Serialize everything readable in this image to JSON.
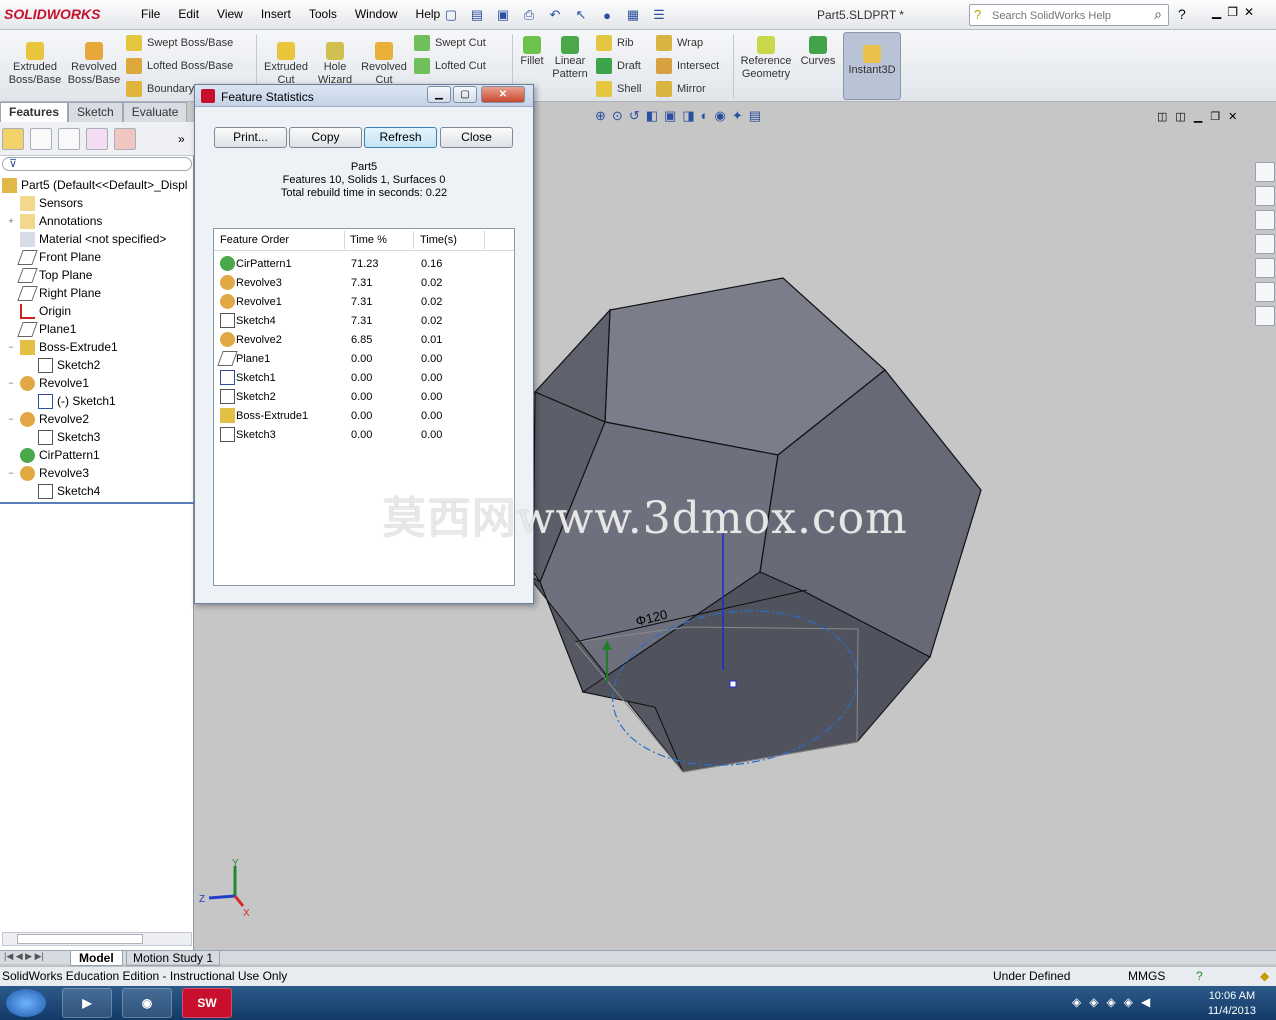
{
  "app": {
    "logo": "SOLIDWORKS",
    "menu": [
      "File",
      "Edit",
      "View",
      "Insert",
      "Tools",
      "Window",
      "Help"
    ],
    "doc_title": "Part5.SLDPRT *",
    "search_placeholder": "Search SolidWorks Help",
    "help_symbol": "?"
  },
  "ribbon": {
    "extruded_boss": "Extruded Boss/Base",
    "revolved_boss": "Revolved Boss/Base",
    "swept_boss": "Swept Boss/Base",
    "lofted_boss": "Lofted Boss/Base",
    "boundary": "Boundary",
    "extruded_cut": "Extruded Cut",
    "hole_wizard": "Hole Wizard",
    "revolved_cut": "Revolved Cut",
    "swept_cut": "Swept Cut",
    "lofted_cut": "Lofted Cut",
    "fillet": "Fillet",
    "linear_pattern": "Linear Pattern",
    "rib": "Rib",
    "draft": "Draft",
    "shell": "Shell",
    "wrap": "Wrap",
    "intersect": "Intersect",
    "mirror": "Mirror",
    "reference_geometry": "Reference Geometry",
    "curves": "Curves",
    "instant3d": "Instant3D"
  },
  "command_tabs": [
    "Features",
    "Sketch",
    "Evaluate"
  ],
  "tree": {
    "root": "Part5  (Default<<Default>_Displ",
    "items": [
      {
        "label": "Sensors",
        "icon": "sensor-icon"
      },
      {
        "label": "Annotations",
        "icon": "annotation-icon"
      },
      {
        "label": "Material <not specified>",
        "icon": "material-icon"
      },
      {
        "label": "Front Plane",
        "icon": "plane-icon"
      },
      {
        "label": "Top Plane",
        "icon": "plane-icon"
      },
      {
        "label": "Right Plane",
        "icon": "plane-icon"
      },
      {
        "label": "Origin",
        "icon": "origin-icon"
      },
      {
        "label": "Plane1",
        "icon": "plane-icon"
      },
      {
        "label": "Boss-Extrude1",
        "icon": "extrude-icon"
      },
      {
        "label": "Sketch2",
        "icon": "sketch-icon"
      },
      {
        "label": "Revolve1",
        "icon": "revolve-icon"
      },
      {
        "label": "(-) Sketch1",
        "icon": "sketch-icon"
      },
      {
        "label": "Revolve2",
        "icon": "revolve-icon"
      },
      {
        "label": "Sketch3",
        "icon": "sketch-icon"
      },
      {
        "label": "CirPattern1",
        "icon": "pattern-icon"
      },
      {
        "label": "Revolve3",
        "icon": "revolve-icon"
      },
      {
        "label": "Sketch4",
        "icon": "sketch-icon"
      }
    ]
  },
  "dialog": {
    "title": "Feature Statistics",
    "buttons": {
      "print": "Print...",
      "copy": "Copy",
      "refresh": "Refresh",
      "close": "Close"
    },
    "part_name": "Part5",
    "counts_line": "Features 10, Solids 1, Surfaces 0",
    "rebuild_line": "Total rebuild time in seconds: 0.22",
    "columns": [
      "Feature Order",
      "Time %",
      "Time(s)"
    ],
    "rows": [
      {
        "name": "CirPattern1",
        "pct": "71.23",
        "time": "0.16",
        "icon": "pattern-icon"
      },
      {
        "name": "Revolve3",
        "pct": "7.31",
        "time": "0.02",
        "icon": "revolve-icon"
      },
      {
        "name": "Revolve1",
        "pct": "7.31",
        "time": "0.02",
        "icon": "revolve-icon"
      },
      {
        "name": "Sketch4",
        "pct": "7.31",
        "time": "0.02",
        "icon": "sketch-icon"
      },
      {
        "name": "Revolve2",
        "pct": "6.85",
        "time": "0.01",
        "icon": "revolve-icon"
      },
      {
        "name": "Plane1",
        "pct": "0.00",
        "time": "0.00",
        "icon": "plane-icon"
      },
      {
        "name": "Sketch1",
        "pct": "0.00",
        "time": "0.00",
        "icon": "sketch-icon"
      },
      {
        "name": "Sketch2",
        "pct": "0.00",
        "time": "0.00",
        "icon": "sketch-icon"
      },
      {
        "name": "Boss-Extrude1",
        "pct": "0.00",
        "time": "0.00",
        "icon": "extrude-icon"
      },
      {
        "name": "Sketch3",
        "pct": "0.00",
        "time": "0.00",
        "icon": "sketch-icon"
      }
    ]
  },
  "viewport": {
    "dimension_label": "Φ120",
    "watermark": "莫西网www.3dmox.com",
    "triad": {
      "y": "Y",
      "z": "Z",
      "x": "X"
    }
  },
  "bottom_tabs": [
    "Model",
    "Motion Study 1"
  ],
  "status": {
    "left": "SolidWorks Education Edition - Instructional Use Only",
    "state": "Under Defined",
    "units": "MMGS"
  },
  "taskbar": {
    "time": "10:06 AM",
    "date": "11/4/2013",
    "sw_label": "SW"
  },
  "colors": {
    "part_face": "#6f7180",
    "part_face_light": "#7d7f8d",
    "sketch_blue": "#2a6fc9",
    "accent_red": "#c8102e"
  }
}
